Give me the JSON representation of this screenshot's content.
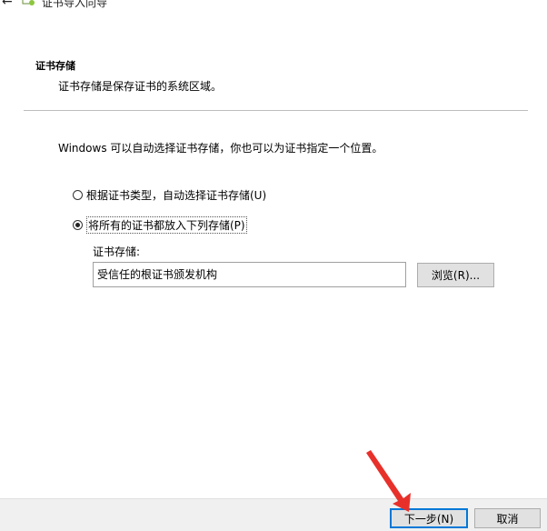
{
  "window": {
    "title": "证书导入向导",
    "back_icon": "back-arrow-icon",
    "app_icon": "certificate-wizard-icon"
  },
  "header": {
    "title": "证书存储",
    "description": "证书存储是保存证书的系统区域。"
  },
  "main": {
    "intro": "Windows 可以自动选择证书存储，你也可以为证书指定一个位置。",
    "options": [
      {
        "label": "根据证书类型，自动选择证书存储(U)",
        "selected": false
      },
      {
        "label": "将所有的证书都放入下列存储(P)",
        "selected": true
      }
    ],
    "store_label": "证书存储:",
    "store_value": "受信任的根证书颁发机构",
    "browse_label": "浏览(R)..."
  },
  "footer": {
    "next_label": "下一步(N)",
    "cancel_label": "取消"
  },
  "colors": {
    "accent": "#0078d7",
    "annotation_arrow": "#e8302a",
    "footer_bg": "#f0f0f0"
  }
}
